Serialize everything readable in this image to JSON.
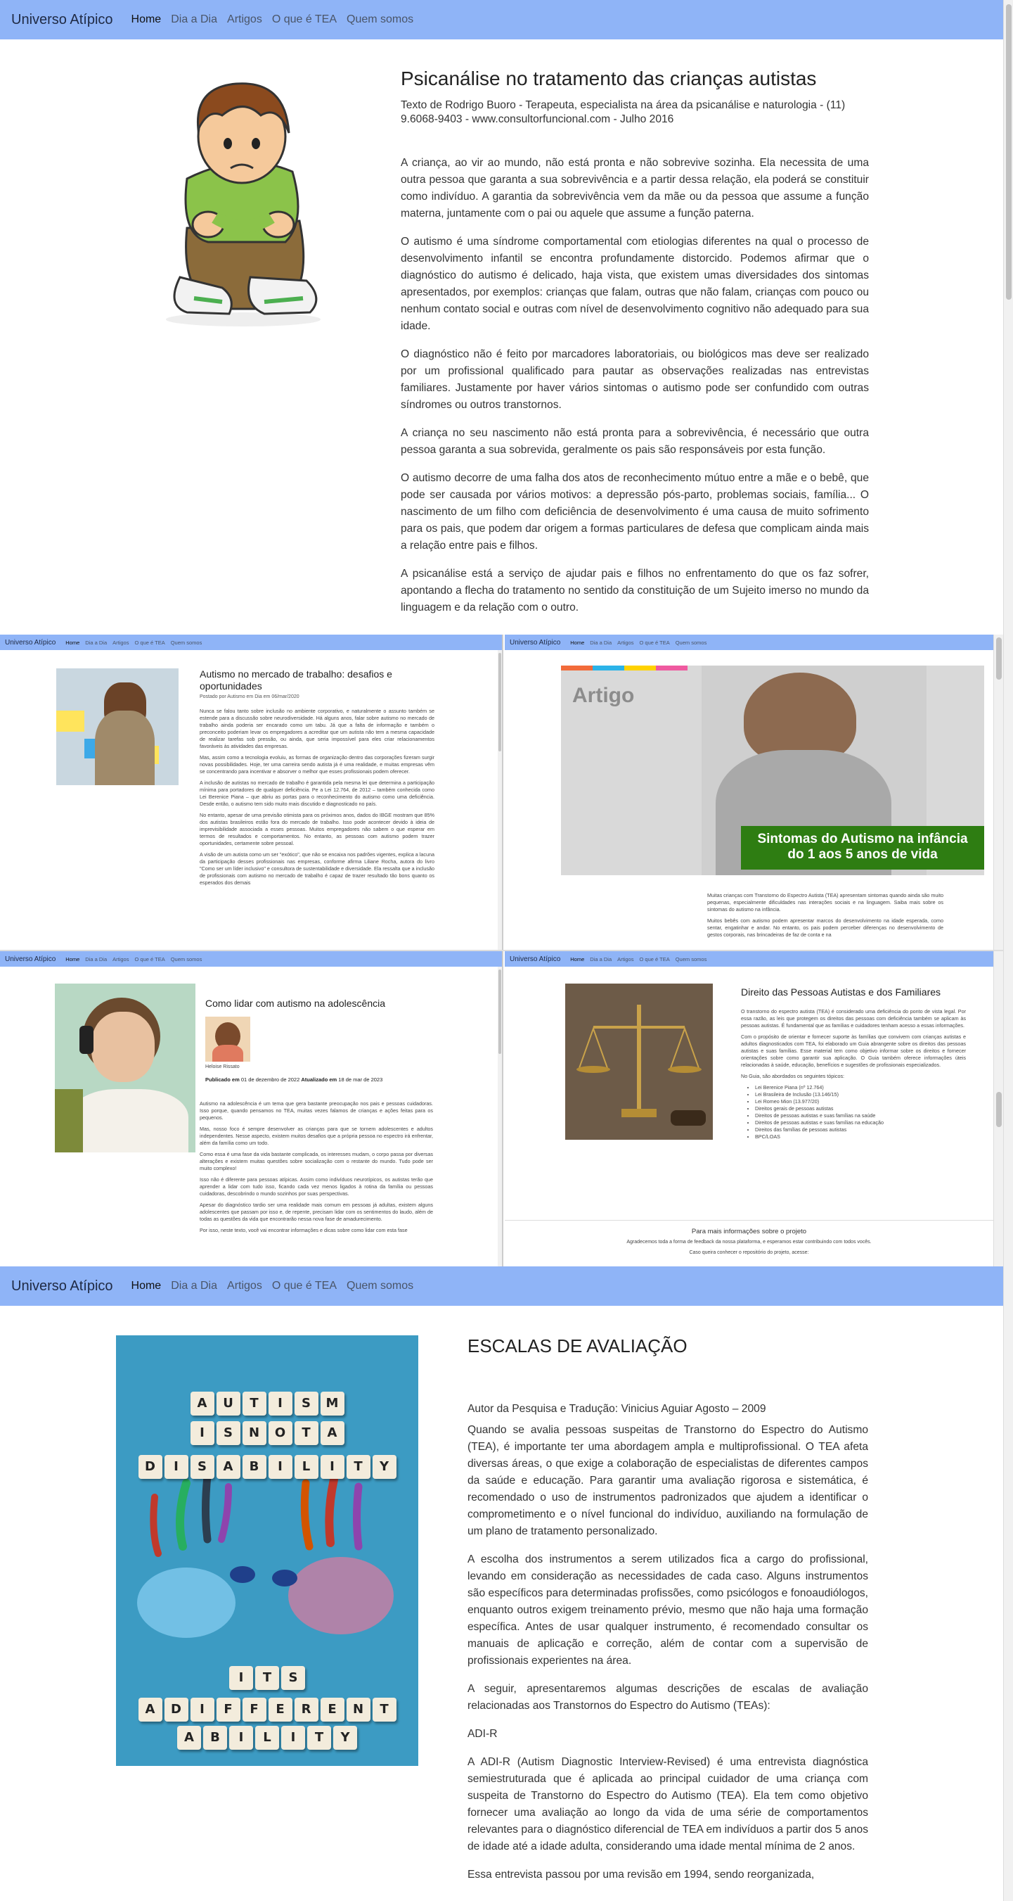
{
  "nav": {
    "brand": "Universo Atípico",
    "items": [
      "Home",
      "Dia a Dia",
      "Artigos",
      "O que é TEA",
      "Quem somos"
    ]
  },
  "article1": {
    "title": "Psicanálise no tratamento das crianças autistas",
    "subtitle": "Texto de Rodrigo Buoro - Terapeuta, especialista na área da psicanálise e naturologia - (11) 9.6068-9403 - www.consultorfuncional.com - Julho 2016",
    "paragraphs": [
      "A criança, ao vir ao mundo, não está pronta e não sobrevive sozinha. Ela necessita de uma outra pessoa que garanta a sua sobrevivência e a partir dessa relação, ela poderá se constituir como indivíduo. A garantia da sobrevivência vem da mãe ou da pessoa que assume a função materna, juntamente com o pai ou aquele que assume a função paterna.",
      "O autismo é uma síndrome comportamental com etiologias diferentes na qual o processo de desenvolvimento infantil se encontra profundamente distorcido. Podemos afirmar que o diagnóstico do autismo é delicado, haja vista, que existem umas diversidades dos sintomas apresentados, por exemplos: crianças que falam, outras que não falam, crianças com pouco ou nenhum contato social e outras com nível de desenvolvimento cognitivo não adequado para sua idade.",
      "O diagnóstico não é feito por marcadores laboratoriais, ou biológicos mas deve ser realizado por um profissional qualificado para pautar as observações realizadas nas entrevistas familiares. Justamente por haver vários sintomas o autismo pode ser confundido com outras síndromes ou outros transtornos.",
      "A criança no seu nascimento não está pronta para a sobrevivência, é necessário que outra pessoa garanta a sua sobrevida, geralmente os pais são responsáveis por esta função.",
      "O autismo decorre de uma falha dos atos de reconhecimento mútuo entre a mãe e o bebê, que pode ser causada por vários motivos: a depressão pós-parto, problemas sociais, família... O nascimento de um filho com deficiência de desenvolvimento é uma causa de muito sofrimento para os pais, que podem dar origem a formas particulares de defesa que complicam ainda mais a relação entre pais e filhos.",
      "A psicanálise está a serviço de ajudar pais e filhos no enfrentamento do que os faz sofrer, apontando a flecha do tratamento no sentido da constituição de um Sujeito imerso no mundo da linguagem e da relação com o outro."
    ]
  },
  "mini1": {
    "title": "Autismo no mercado de trabalho: desafios e oportunidades",
    "meta": "Postado por Autismo em Dia em 06/mar/2020",
    "paragraphs": [
      "Nunca se falou tanto sobre inclusão no ambiente corporativo, e naturalmente o assunto também se estende para a discussão sobre neurodiversidade. Há alguns anos, falar sobre autismo no mercado de trabalho ainda poderia ser encarado como um tabu. Já que a falta de informação e também o preconceito poderiam levar os empregadores a acreditar que um autista não tem a mesma capacidade de realizar tarefas sob pressão, ou ainda, que seria impossível para eles criar relacionamentos favoráveis às atividades das empresas.",
      "Mas, assim como a tecnologia evoluiu, as formas de organização dentro das corporações fizeram surgir novas possibilidades. Hoje, ter uma carreira sendo autista já é uma realidade, e muitas empresas vêm se concentrando para incentivar e absorver o melhor que esses profissionais podem oferecer.",
      "A inclusão de autistas no mercado de trabalho é garantida pela mesma lei que determina a participação mínima para portadores de qualquer deficiência. Pe a Lei 12.764, de 2012 – também conhecida como Lei Berenice Piana – que abriu as portas para o reconhecimento do autismo como uma deficiência. Desde então, o autismo tem sido muito mais discutido e diagnosticado no país.",
      "No entanto, apesar de uma previsão otimista para os próximos anos, dados do IBGE mostram que 85% dos autistas brasileiros estão fora do mercado de trabalho. Isso pode acontecer devido à ideia de imprevisibilidade associada a esses pessoas. Muitos empregadores não sabem o que esperar em termos de resultados e comportamentos. No entanto, as pessoas com autismo podem trazer oportunidades, certamente sobre pessoal.",
      "A visão de um autista como um ser \"exótico\", que não se encaixa nos padrões vigentes, explica a lacuna da participação desses profissionais nas empresas, conforme afirma Liliane Rocha, autora do livro \"Como ser um líder inclusivo\" e consultora de sustentabilidade e diversidade. Ela ressalta que a inclusão de profissionais com autismo no mercado de trabalho é capaz de trazer resultado tão bons quanto os esperados dos demais"
    ]
  },
  "mini2": {
    "banner_brand": "Artigo",
    "banner_headline": "Sintomas do Autismo na infância do 1 aos 5 anos de vida",
    "paragraphs": [
      "Muitas crianças com Transtorno do Espectro Autista (TEA) apresentam sintomas quando ainda são muito pequenas, especialmente dificuldades nas interações sociais e na linguagem. Saiba mais sobre os sintomas do autismo na infância.",
      "Muitos bebês com autismo podem apresentar marcos do desenvolvimento na idade esperada, como sentar, engatinhar e andar. No entanto, os pais podem perceber diferenças no desenvolvimento de gestos corporais, nas brincadeiras de faz de conta e na"
    ]
  },
  "mini3": {
    "title": "Como lidar com autismo na adolescência",
    "author": "Heloise Rissato",
    "published_label": "Publicado em",
    "published_date": "01 de dezembro de 2022",
    "updated_label": "Atualizado em",
    "updated_date": "18 de mar de 2023",
    "paragraphs": [
      "Autismo na adolescência é um tema que gera bastante preocupação nos pais e pessoas cuidadoras. Isso porque, quando pensamos no TEA, muitas vezes falamos de crianças e ações feitas para os pequenos.",
      "Mas, nosso foco é sempre desenvolver as crianças para que se tornem adolescentes e adultos independentes. Nesse aspecto, existem muitos desafios que a própria pessoa no espectro irá enfrentar, além da família como um todo.",
      "Como essa é uma fase da vida bastante complicada, os interesses mudam, o corpo passa por diversas alterações e existem muitas questões sobre socialização com o restante do mundo. Tudo pode ser muito complexo!",
      "Isso não é diferente para pessoas atípicas. Assim como indivíduos neurotípicos, os autistas terão que aprender a lidar com tudo isso, ficando cada vez menos ligados à rotina da família ou pessoas cuidadoras, descobrindo o mundo sozinhos por suas perspectivas.",
      "Apesar do diagnóstico tardio ser uma realidade mais comum em pessoas já adultas, existem alguns adolescentes que passam por isso e, de repente, precisam lidar com os sentimentos do laudo, além de todas as questões da vida que encontrarão nessa nova fase de amadurecimento.",
      "Por isso, neste texto, você vai encontrar informações e dicas sobre como lidar com esta fase"
    ]
  },
  "mini4": {
    "title": "Direito das Pessoas Autistas e dos Familiares",
    "paragraphs": [
      "O transtorno do espectro autista (TEA) é considerado uma deficiência do ponto de vista legal. Por essa razão, as leis que protegem os direitos das pessoas com deficiência também se aplicam às pessoas autistas. É fundamental que as famílias e cuidadores tenham acesso a essas informações.",
      "Com o propósito de orientar e fornecer suporte às famílias que convivem com crianças autistas e adultos diagnosticados com TEA, foi elaborado um Guia abrangente sobre os direitos das pessoas autistas e suas famílias. Esse material tem como objetivo informar sobre os direitos e fornecer orientações sobre como garantir sua aplicação. O Guia também oferece informações úteis relacionadas à saúde, educação, benefícios e sugestões de profissionais especializados.",
      "No Guia, são abordados os seguintes tópicos:"
    ],
    "topics": [
      "Lei Berenice Piana (nº 12.764)",
      "Lei Brasileira de Inclusão (13.146/15)",
      "Lei Romeo Mion (13.977/20)",
      "Direitos gerais de pessoas autistas",
      "Direitos de pessoas autistas e suas famílias na saúde",
      "Direitos de pessoas autistas e suas famílias na educação",
      "Direitos das famílias de pessoas autistas",
      "BPC/LOAS"
    ],
    "footer_title": "Para mais informações sobre o projeto",
    "footer_line1": "Agradecemos toda a forma de feedback da nossa plataforma, e esperamos estar contribuindo com todos vocês.",
    "footer_line2": "Caso queira conhecer o repositório do projeto, acesse:"
  },
  "article2": {
    "title": "ESCALAS DE AVALIAÇÃO",
    "author": "Autor da Pesquisa e Tradução: Vinicius Aguiar Agosto – 2009",
    "paragraphs": [
      "Quando se avalia pessoas suspeitas de Transtorno do Espectro do Autismo (TEA), é importante ter uma abordagem ampla e multiprofissional. O TEA afeta diversas áreas, o que exige a colaboração de especialistas de diferentes campos da saúde e educação. Para garantir uma avaliação rigorosa e sistemática, é recomendado o uso de instrumentos padronizados que ajudem a identificar o comprometimento e o nível funcional do indivíduo, auxiliando na formulação de um plano de tratamento personalizado.",
      "A escolha dos instrumentos a serem utilizados fica a cargo do profissional, levando em consideração as necessidades de cada caso. Alguns instrumentos são específicos para determinadas profissões, como psicólogos e fonoaudiólogos, enquanto outros exigem treinamento prévio, mesmo que não haja uma formação específica. Antes de usar qualquer instrumento, é recomendado consultar os manuais de aplicação e correção, além de contar com a supervisão de profissionais experientes na área.",
      "A seguir, apresentaremos algumas descrições de escalas de avaliação relacionadas aos Transtornos do Espectro do Autismo (TEAs):"
    ],
    "section_label": "ADI-R",
    "adi_paragraph": "A ADI-R (Autism Diagnostic Interview-Revised) é uma entrevista diagnóstica semiestruturada que é aplicada ao principal cuidador de uma criança com suspeita de Transtorno do Espectro do Autismo (TEA). Ela tem como objetivo fornecer uma avaliação ao longo da vida de uma série de comportamentos relevantes para o diagnóstico diferencial de TEA em indivíduos a partir dos 5 anos de idade até a idade adulta, considerando uma idade mental mínima de 2 anos.",
    "last_paragraph": "Essa entrevista passou por uma revisão em 1994, sendo reorganizada,",
    "tiles": [
      [
        "A",
        "U",
        "T",
        "I",
        "S",
        "M"
      ],
      [
        "I",
        "S",
        "N",
        "O",
        "T",
        "A"
      ],
      [
        "D",
        "I",
        "S",
        "A",
        "B",
        "I",
        "L",
        "I",
        "T",
        "Y"
      ],
      [
        "I",
        "T",
        "S"
      ],
      [
        "A",
        "D",
        "I",
        "F",
        "F",
        "E",
        "R",
        "E",
        "N",
        "T"
      ],
      [
        "A",
        "B",
        "I",
        "L",
        "I",
        "T",
        "Y"
      ]
    ]
  },
  "colors": {
    "navbar": "#8fb4f7",
    "banner_green": "#2e7d12"
  }
}
